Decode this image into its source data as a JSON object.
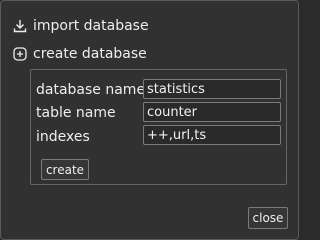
{
  "actions": {
    "import_label": "import database",
    "import_icon": "download-icon",
    "create_label": "create database",
    "create_icon": "plus-circle-icon"
  },
  "form": {
    "fields": [
      {
        "label": "database name",
        "value": "statistics"
      },
      {
        "label": "table name",
        "value": "counter"
      },
      {
        "label": "indexes",
        "value": "++,url,ts"
      }
    ],
    "create_label": "create"
  },
  "footer": {
    "close_label": "close"
  },
  "colors": {
    "background": "#313131",
    "border": "#5a5a5a",
    "text": "#eeeeee",
    "input_background": "#2a2a2a"
  }
}
